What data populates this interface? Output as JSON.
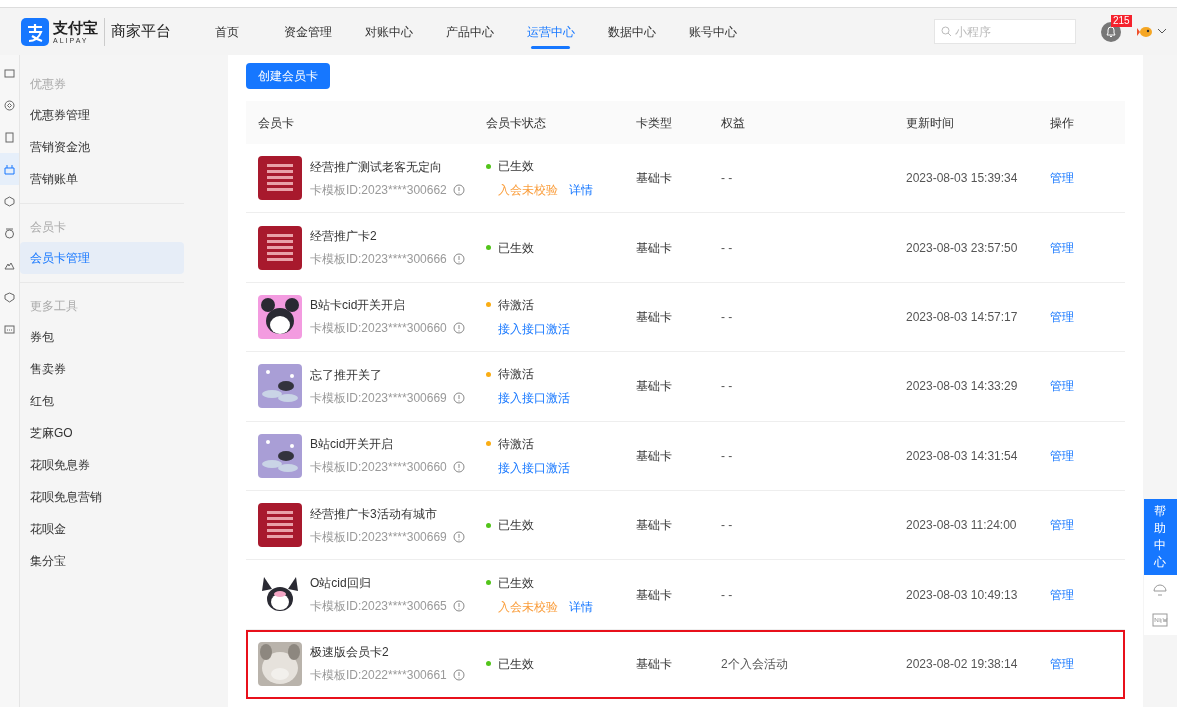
{
  "header": {
    "logo_text": "支付宝",
    "logo_sub": "ALIPAY",
    "platform": "商家平台",
    "nav": [
      {
        "label": "首页",
        "selected": false
      },
      {
        "label": "资金管理",
        "selected": false
      },
      {
        "label": "对账中心",
        "selected": false
      },
      {
        "label": "产品中心",
        "selected": false
      },
      {
        "label": "运营中心",
        "selected": true
      },
      {
        "label": "数据中心",
        "selected": false
      },
      {
        "label": "账号中心",
        "selected": false
      }
    ],
    "search": {
      "placeholder": "小程序"
    },
    "notification_count": "215"
  },
  "rail": [
    {
      "selected": false
    },
    {
      "selected": false
    },
    {
      "selected": false
    },
    {
      "selected": true
    },
    {
      "selected": false
    },
    {
      "selected": false
    },
    {
      "selected": false
    },
    {
      "selected": false
    },
    {
      "selected": false
    }
  ],
  "sidebar": {
    "groups": [
      {
        "heading": "优惠券",
        "items": [
          {
            "label": "优惠券管理",
            "selected": false
          },
          {
            "label": "营销资金池",
            "selected": false
          },
          {
            "label": "营销账单",
            "selected": false
          }
        ]
      },
      {
        "heading": "会员卡",
        "items": [
          {
            "label": "会员卡管理",
            "selected": true
          }
        ]
      },
      {
        "heading": "更多工具",
        "items": [
          {
            "label": "券包",
            "selected": false
          },
          {
            "label": "售卖券",
            "selected": false
          },
          {
            "label": "红包",
            "selected": false
          },
          {
            "label": "芝麻GO",
            "selected": false
          },
          {
            "label": "花呗免息券",
            "selected": false
          },
          {
            "label": "花呗免息营销",
            "selected": false
          },
          {
            "label": "花呗金",
            "selected": false
          },
          {
            "label": "集分宝",
            "selected": false
          }
        ]
      }
    ]
  },
  "create_button": "创建会员卡",
  "table": {
    "columns": [
      "会员卡",
      "会员卡状态",
      "卡类型",
      "权益",
      "更新时间",
      "操作"
    ],
    "rows": [
      {
        "name": "经营推广测试老客无定向",
        "template_id": "卡模板ID:2023****300662",
        "status": {
          "kind": "active",
          "label": "已生效"
        },
        "note": "入会未校验",
        "link": "详情",
        "card_type": "基础卡",
        "benefit": "- -",
        "updated": "2023-08-03 15:39:34",
        "action": "管理",
        "highlighted": false
      },
      {
        "name": "经营推广卡2",
        "template_id": "卡模板ID:2023****300666",
        "status": {
          "kind": "active",
          "label": "已生效"
        },
        "card_type": "基础卡",
        "benefit": "- -",
        "updated": "2023-08-03 23:57:50",
        "action": "管理",
        "highlighted": false
      },
      {
        "name": "B站卡cid开关开启",
        "template_id": "卡模板ID:2023****300660",
        "status": {
          "kind": "pending",
          "label": "待激活"
        },
        "link": "接入接口激活",
        "card_type": "基础卡",
        "benefit": "- -",
        "updated": "2023-08-03 14:57:17",
        "action": "管理",
        "highlighted": false
      },
      {
        "name": "忘了推开关了",
        "template_id": "卡模板ID:2023****300669",
        "status": {
          "kind": "pending",
          "label": "待激活"
        },
        "link": "接入接口激活",
        "card_type": "基础卡",
        "benefit": "- -",
        "updated": "2023-08-03 14:33:29",
        "action": "管理",
        "highlighted": false
      },
      {
        "name": "B站cid开关开启",
        "template_id": "卡模板ID:2023****300660",
        "status": {
          "kind": "pending",
          "label": "待激活"
        },
        "link": "接入接口激活",
        "card_type": "基础卡",
        "benefit": "- -",
        "updated": "2023-08-03 14:31:54",
        "action": "管理",
        "highlighted": false
      },
      {
        "name": "经营推广卡3活动有城市",
        "template_id": "卡模板ID:2023****300669",
        "status": {
          "kind": "active",
          "label": "已生效"
        },
        "card_type": "基础卡",
        "benefit": "- -",
        "updated": "2023-08-03 11:24:00",
        "action": "管理",
        "highlighted": false
      },
      {
        "name": "O站cid回归",
        "template_id": "卡模板ID:2023****300665",
        "status": {
          "kind": "active",
          "label": "已生效"
        },
        "note": "入会未校验",
        "link": "详情",
        "card_type": "基础卡",
        "benefit": "- -",
        "updated": "2023-08-03 10:49:13",
        "action": "管理",
        "highlighted": false
      },
      {
        "name": "极速版会员卡2",
        "template_id": "卡模板ID:2022****300661",
        "status": {
          "kind": "active",
          "label": "已生效"
        },
        "card_type": "基础卡",
        "benefit": "2个入会活动",
        "updated": "2023-08-02 19:38:14",
        "action": "管理",
        "highlighted": true
      }
    ]
  },
  "help": {
    "label": "帮助中心"
  }
}
